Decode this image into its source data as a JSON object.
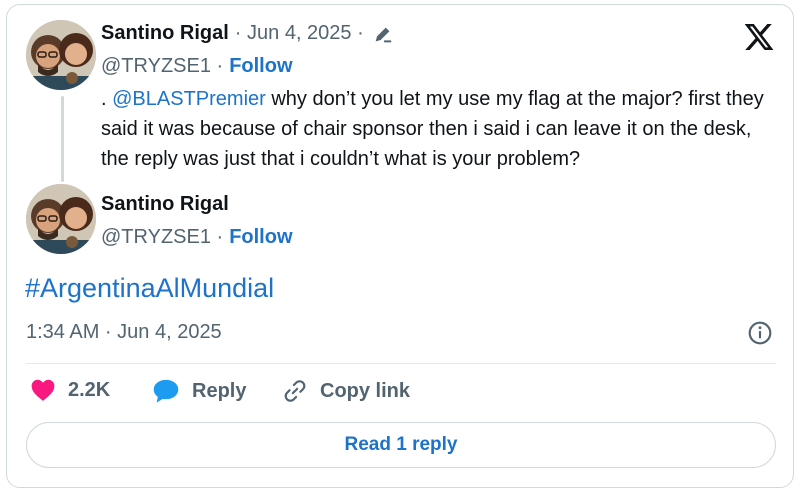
{
  "quoted_post": {
    "author_name": "Santino Rigal",
    "date": "· Jun 4, 2025 ·",
    "handle": "@TRYZSE1 ·",
    "follow_label": "Follow",
    "body_prefix": ". ",
    "mention": "@BLASTPremier",
    "body_rest": " why don’t you let my use my flag at the major? first they said it was because of chair sponsor then i said i can leave it on the desk, the reply was just that i couldn’t what is your problem?"
  },
  "main_post": {
    "author_name": "Santino Rigal",
    "handle": "@TRYZSE1 ·",
    "follow_label": "Follow",
    "hashtag": "#ArgentinaAlMundial",
    "timestamp": "1:34 AM · Jun 4, 2025"
  },
  "actions": {
    "likes_count": "2.2K",
    "reply_label": "Reply",
    "copy_link_label": "Copy link"
  },
  "read_replies_label": "Read 1 reply",
  "icons": {
    "brand": "x-logo-icon",
    "edited": "pencil-icon",
    "like": "heart-icon",
    "reply": "speech-bubble-icon",
    "copy": "link-icon",
    "info": "info-icon"
  },
  "colors": {
    "link": "#1d73c9",
    "like": "#f91880",
    "reply_icon": "#1d9bf0",
    "muted": "#536471",
    "border": "#cfd9de"
  }
}
